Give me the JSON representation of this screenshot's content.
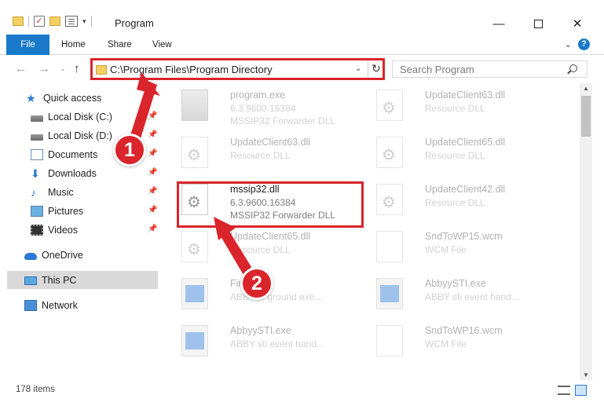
{
  "window": {
    "title": "Program",
    "minimize_glyph": "—",
    "close_glyph": "✕"
  },
  "quick_access_toolbar": {
    "check_glyph": "✓",
    "dropdown_glyph": "▾"
  },
  "ribbon": {
    "tabs": [
      {
        "label": "File",
        "active": true
      },
      {
        "label": "Home"
      },
      {
        "label": "Share"
      },
      {
        "label": "View"
      }
    ],
    "expand_glyph": "⌄",
    "help_glyph": "?"
  },
  "navigation": {
    "back_glyph": "←",
    "forward_glyph": "→",
    "recent_glyph": "⌄",
    "up_glyph": "↑",
    "address": "C:\\Program Files\\Program Directory",
    "address_dropdown_glyph": "⌄",
    "refresh_glyph": "↻",
    "search_placeholder": "Search Program"
  },
  "sidebar": {
    "items": [
      {
        "label": "Quick access",
        "icon": "star-icon",
        "glyph": "★"
      },
      {
        "label": "Local Disk (C:)",
        "icon": "drive-icon",
        "pinned": true
      },
      {
        "label": "Local Disk (D:)",
        "icon": "drive-icon",
        "pinned": true
      },
      {
        "label": "Documents",
        "icon": "documents-icon",
        "pinned": true
      },
      {
        "label": "Downloads",
        "icon": "download-icon",
        "glyph": "⬇",
        "pinned": true
      },
      {
        "label": "Music",
        "icon": "music-icon",
        "glyph": "♪",
        "pinned": true
      },
      {
        "label": "Pictures",
        "icon": "pictures-icon",
        "pinned": true
      },
      {
        "label": "Videos",
        "icon": "videos-icon",
        "pinned": true
      },
      {
        "label": "OneDrive",
        "icon": "cloud-icon"
      },
      {
        "label": "This PC",
        "icon": "computer-icon",
        "selected": true
      },
      {
        "label": "Network",
        "icon": "network-icon"
      }
    ],
    "pin_glyph": "📌"
  },
  "files": [
    {
      "name": "program.exe",
      "line2": "6.3.9600.16384",
      "line3": "MSSIP32 Forwarder DLL",
      "icon": "program-icon"
    },
    {
      "name": "UpdateClient63.dll",
      "line2": "Resource DLL",
      "icon": "dll-icon"
    },
    {
      "name": "UpdateClient63.dll",
      "line2": "Resource DLL",
      "icon": "dll-icon"
    },
    {
      "name": "UpdateClient65.dll",
      "line2": "Resource DLL",
      "icon": "dll-icon"
    },
    {
      "name": "mssip32.dll",
      "line2": "6.3.9600.16384",
      "line3": "MSSIP32 Forwarder DLL",
      "icon": "dll-icon",
      "highlighted": true
    },
    {
      "name": "UpdateClient42.dll",
      "line2": "Resource DLL",
      "icon": "dll-icon"
    },
    {
      "name": "UpdateClient65.dll",
      "line2": "Resource DLL",
      "icon": "dll-icon"
    },
    {
      "name": "SndToWP15.wcm",
      "line2": "WCM File",
      "icon": "file-icon"
    },
    {
      "name": "Fina…",
      "line2": "ABBY… ground exe…",
      "icon": "exe-icon"
    },
    {
      "name": "AbbyySTI.exe",
      "line2": "ABBY sti event hand…",
      "icon": "exe-icon"
    },
    {
      "name": "AbbyySTI.exe",
      "line2": "ABBY sti event hand…",
      "icon": "exe-icon"
    },
    {
      "name": "SndToWP16.wcm",
      "line2": "WCM File",
      "icon": "file-icon"
    }
  ],
  "callouts": [
    {
      "number": "1"
    },
    {
      "number": "2"
    }
  ],
  "scrollbar": {
    "up_glyph": "▲",
    "down_glyph": "▼"
  },
  "status": {
    "item_count": "178 items"
  },
  "colors": {
    "accent": "#1979ca",
    "highlight_red": "#d9252b",
    "selected_nav": "#d9d9d9"
  }
}
